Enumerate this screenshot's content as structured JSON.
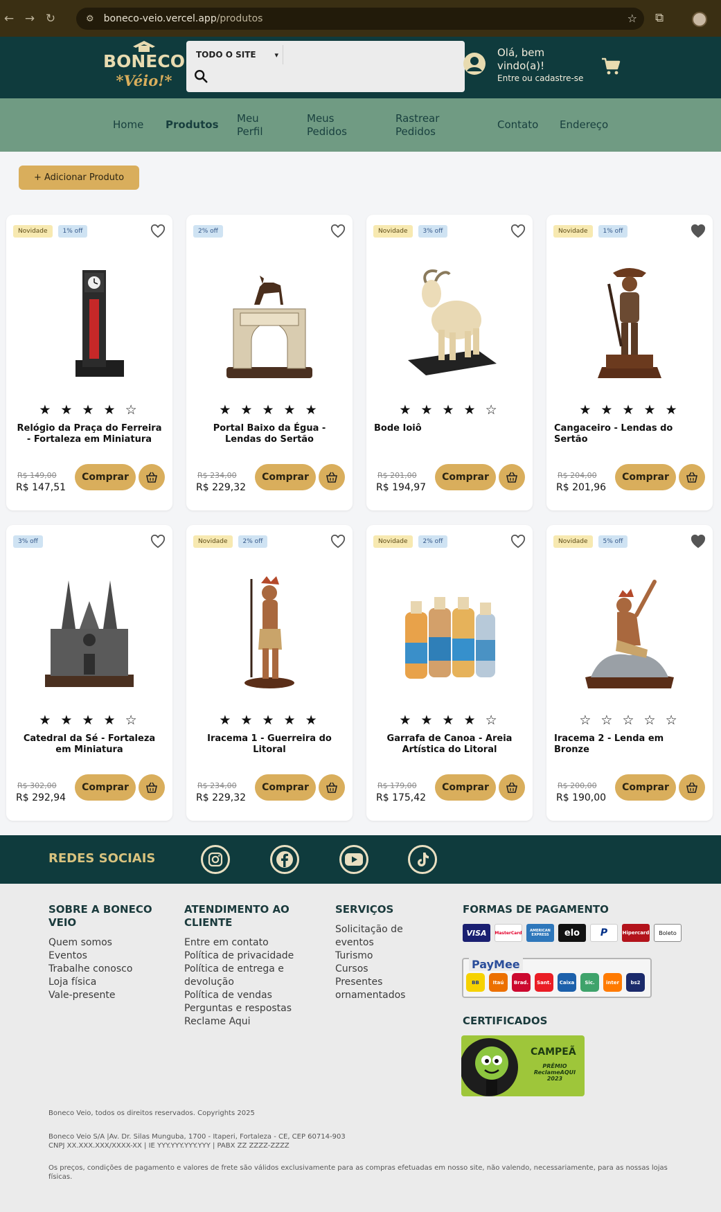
{
  "browser": {
    "url_host": "boneco-veio.vercel.app",
    "url_path": "/produtos"
  },
  "header": {
    "logo_line1": "BONECO",
    "logo_line2": "*Véio!*",
    "search_category": "TODO O SITE",
    "search_placeholder": "",
    "greeting": "Olá, bem vindo(a)!",
    "login_link": "Entre ou cadastre-se"
  },
  "nav": {
    "items": [
      {
        "label": "Home"
      },
      {
        "label": "Produtos"
      },
      {
        "label": "Meu Perfil"
      },
      {
        "label": "Meus Pedidos"
      },
      {
        "label": "Rastrear Pedidos"
      },
      {
        "label": "Contato"
      },
      {
        "label": "Endereço"
      }
    ]
  },
  "actions": {
    "add_product": "+ Adicionar Produto"
  },
  "products": [
    {
      "name": "Relógio da Praça do Ferreira - Fortaleza em Miniatura",
      "old_price": "R$ 149,00",
      "price": "R$ 147,51",
      "stars": "★ ★ ★ ★ ☆",
      "badge_new": "Novidade",
      "badge_off": "1% off",
      "buy": "Comprar",
      "favorited": false
    },
    {
      "name": "Portal Baixo da Égua - Lendas do Sertão",
      "old_price": "R$ 234,00",
      "price": "R$ 229,32",
      "stars": "★ ★ ★ ★ ★",
      "badge_new": "",
      "badge_off": "2% off",
      "buy": "Comprar",
      "favorited": false
    },
    {
      "name": "Bode Ioiô",
      "old_price": "R$ 201,00",
      "price": "R$ 194,97",
      "stars": "★ ★ ★ ★ ☆",
      "badge_new": "Novidade",
      "badge_off": "3% off",
      "buy": "Comprar",
      "favorited": false
    },
    {
      "name": "Cangaceiro - Lendas do Sertão",
      "old_price": "R$ 204,00",
      "price": "R$ 201,96",
      "stars": "★ ★ ★ ★ ★",
      "badge_new": "Novidade",
      "badge_off": "1% off",
      "buy": "Comprar",
      "favorited": true
    },
    {
      "name": "Catedral da Sé - Fortaleza em Miniatura",
      "old_price": "R$ 302,00",
      "price": "R$ 292,94",
      "stars": "★ ★ ★ ★ ☆",
      "badge_new": "",
      "badge_off": "3% off",
      "buy": "Comprar",
      "favorited": false
    },
    {
      "name": "Iracema 1 - Guerreira do Litoral",
      "old_price": "R$ 234,00",
      "price": "R$ 229,32",
      "stars": "★ ★ ★ ★ ★",
      "badge_new": "Novidade",
      "badge_off": "2% off",
      "buy": "Comprar",
      "favorited": false
    },
    {
      "name": "Garrafa de Canoa - Areia Artística do Litoral",
      "old_price": "R$ 179,00",
      "price": "R$ 175,42",
      "stars": "★ ★ ★ ★ ☆",
      "badge_new": "Novidade",
      "badge_off": "2% off",
      "buy": "Comprar",
      "favorited": false
    },
    {
      "name": "Iracema 2 - Lenda em Bronze",
      "old_price": "R$ 200,00",
      "price": "R$ 190,00",
      "stars": "☆ ☆ ☆ ☆ ☆",
      "badge_new": "Novidade",
      "badge_off": "5% off",
      "buy": "Comprar",
      "favorited": true
    }
  ],
  "social": {
    "title": "REDES SOCIAIS",
    "icons": [
      "instagram-icon",
      "facebook-icon",
      "youtube-icon",
      "tiktok-icon"
    ]
  },
  "footer": {
    "about": {
      "title": "SOBRE A BONECO VEIO",
      "links": [
        "Quem somos",
        "Eventos",
        "Trabalhe conosco",
        "Loja física",
        "Vale-presente"
      ]
    },
    "service": {
      "title": "ATENDIMENTO AO CLIENTE",
      "links": [
        "Entre em contato",
        "Política de privacidade",
        "Política de entrega e devolução",
        "Política de vendas",
        "Perguntas e respostas",
        "Reclame Aqui"
      ]
    },
    "services": {
      "title": "SERVIÇOS",
      "links": [
        "Solicitação de eventos",
        "Turismo",
        "Cursos",
        "Presentes ornamentados"
      ]
    },
    "payment": {
      "title": "FORMAS DE PAGAMENTO",
      "methods": [
        "VISA",
        "MasterCard",
        "AMERICAN EXPRESS",
        "elo",
        "P",
        "Hipercard",
        "Boleto"
      ],
      "paymee": "PayMee",
      "banks": [
        "BB",
        "Itaú",
        "Brad.",
        "Sant.",
        "Caixa",
        "Sic.",
        "inter",
        "bs2"
      ]
    },
    "certificates": {
      "title": "CERTIFICADOS",
      "badge_title": "CAMPEÃ",
      "badge_sub": "PRÊMIO ReclameAQUI 2023"
    },
    "copyright": "Boneco Veio, todos os direitos reservados. Copyrights 2025",
    "address1": "Boneco Veio S/A |Av. Dr. Silas Munguba, 1700 - Itaperi, Fortaleza - CE, CEP 60714-903",
    "address2": "CNPJ XX.XXX.XXX/XXXX-XX | IE YYY.YYY.YYY.YYY | PABX ZZ ZZZZ-ZZZZ",
    "disclaimer": "Os preços, condições de pagamento e valores de frete são válidos exclusivamente para as compras efetuadas em nosso site, não valendo, necessariamente, para as nossas lojas físicas."
  },
  "colors": {
    "header_bg": "#0f3b3d",
    "nav_bg": "#709b83",
    "accent": "#d9ae5c",
    "text_dark": "#1a3a3c"
  }
}
